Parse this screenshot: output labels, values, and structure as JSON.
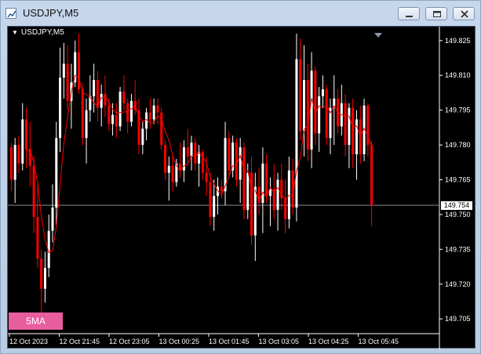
{
  "window": {
    "title": "USDJPY,M5",
    "icon": "chart-window-icon",
    "controls": [
      "minimize-icon",
      "restore-icon",
      "close-icon"
    ]
  },
  "chart": {
    "symbol_label": "USDJPY,M5",
    "indicator_badge": "5MA",
    "current_price": "149.754",
    "colors": {
      "background": "#000000",
      "bull": "#ffffff",
      "bear": "#ff0000",
      "doji": "#00c000",
      "ma_line": "#ff0000",
      "badge": "#e85d9e"
    }
  },
  "chart_data": {
    "type": "candlestick",
    "title": "USDJPY,M5",
    "indicator": "5MA",
    "y_ticks": [
      "149.825",
      "149.810",
      "149.795",
      "149.780",
      "149.765",
      "149.750",
      "149.735",
      "149.720",
      "149.705"
    ],
    "x_ticks": [
      "12 Oct 2023",
      "12 Oct 21:45",
      "12 Oct 23:05",
      "13 Oct 00:25",
      "13 Oct 01:45",
      "13 Oct 03:05",
      "13 Oct 04:25",
      "13 Oct 05:45"
    ],
    "ylim": [
      149.7,
      149.83
    ],
    "current_price": 149.754,
    "candles": [
      [
        149.779,
        149.781,
        149.76,
        149.765
      ],
      [
        149.765,
        149.783,
        149.755,
        149.78
      ],
      [
        149.78,
        149.784,
        149.768,
        149.772
      ],
      [
        149.772,
        149.798,
        149.769,
        149.791
      ],
      [
        149.791,
        149.796,
        149.77,
        149.778
      ],
      [
        149.778,
        149.79,
        149.762,
        149.771
      ],
      [
        149.771,
        149.775,
        149.742,
        149.749
      ],
      [
        149.749,
        149.763,
        149.727,
        149.731
      ],
      [
        149.731,
        149.735,
        149.705,
        149.718
      ],
      [
        149.718,
        149.734,
        149.712,
        149.727
      ],
      [
        149.727,
        149.75,
        149.723,
        149.743
      ],
      [
        149.743,
        149.763,
        149.738,
        149.753
      ],
      [
        149.753,
        149.79,
        149.745,
        149.783
      ],
      [
        149.783,
        149.822,
        149.777,
        149.809
      ],
      [
        149.809,
        149.824,
        149.8,
        149.815
      ],
      [
        149.815,
        149.823,
        149.795,
        149.799
      ],
      [
        149.799,
        149.815,
        149.787,
        149.807
      ],
      [
        149.807,
        149.825,
        149.805,
        149.82
      ],
      [
        149.82,
        149.828,
        149.802,
        149.804
      ],
      [
        149.804,
        149.806,
        149.78,
        149.783
      ],
      [
        149.783,
        149.8,
        149.772,
        149.795
      ],
      [
        149.795,
        149.81,
        149.79,
        149.801
      ],
      [
        149.801,
        149.815,
        149.794,
        149.808
      ],
      [
        149.808,
        149.812,
        149.79,
        149.796
      ],
      [
        149.796,
        149.806,
        149.788,
        149.802
      ],
      [
        149.802,
        149.81,
        149.792,
        149.797
      ],
      [
        149.797,
        149.8,
        149.786,
        149.789
      ],
      [
        149.789,
        149.798,
        149.784,
        149.793
      ],
      [
        149.793,
        149.798,
        149.783,
        149.788
      ],
      [
        149.788,
        149.805,
        149.786,
        149.803
      ],
      [
        149.803,
        149.81,
        149.795,
        149.798
      ],
      [
        149.798,
        149.8,
        149.785,
        149.79
      ],
      [
        149.79,
        149.802,
        149.788,
        149.799
      ],
      [
        149.799,
        149.808,
        149.793,
        149.795
      ],
      [
        149.795,
        149.8,
        149.776,
        149.78
      ],
      [
        149.78,
        149.79,
        149.776,
        149.787
      ],
      [
        149.787,
        149.796,
        149.782,
        149.794
      ],
      [
        149.794,
        149.8,
        149.787,
        149.791
      ],
      [
        149.791,
        149.8,
        149.789,
        149.797
      ],
      [
        149.797,
        149.8,
        149.789,
        149.794
      ],
      [
        149.794,
        149.796,
        149.778,
        149.78
      ],
      [
        149.78,
        149.782,
        149.765,
        149.768
      ],
      [
        149.768,
        149.775,
        149.756,
        149.771
      ],
      [
        149.771,
        149.776,
        149.76,
        149.764
      ],
      [
        149.764,
        149.774,
        149.762,
        149.772
      ],
      [
        149.772,
        149.781,
        149.766,
        149.769
      ],
      [
        149.769,
        149.782,
        149.764,
        149.779
      ],
      [
        149.779,
        149.787,
        149.771,
        149.775
      ],
      [
        149.775,
        149.784,
        149.769,
        149.781
      ],
      [
        149.781,
        149.783,
        149.769,
        149.772
      ],
      [
        149.772,
        149.78,
        149.762,
        149.777
      ],
      [
        149.777,
        149.778,
        149.765,
        149.768
      ],
      [
        149.768,
        149.775,
        149.758,
        149.764
      ],
      [
        149.764,
        149.768,
        149.745,
        149.749
      ],
      [
        149.749,
        149.765,
        149.743,
        149.758
      ],
      [
        149.758,
        149.766,
        149.75,
        149.762
      ],
      [
        149.762,
        149.765,
        149.757,
        149.76
      ],
      [
        149.76,
        149.79,
        149.754,
        149.783
      ],
      [
        149.783,
        149.786,
        149.766,
        149.769
      ],
      [
        149.769,
        149.784,
        149.766,
        149.781
      ],
      [
        149.781,
        149.783,
        149.762,
        149.765
      ],
      [
        149.765,
        149.783,
        149.755,
        149.779
      ],
      [
        149.779,
        149.781,
        149.748,
        149.752
      ],
      [
        149.752,
        149.772,
        149.748,
        149.768
      ],
      [
        149.768,
        149.775,
        149.737,
        149.741
      ],
      [
        149.741,
        149.768,
        149.73,
        149.762
      ],
      [
        149.762,
        149.77,
        149.75,
        149.755
      ],
      [
        149.755,
        149.779,
        149.742,
        149.772
      ],
      [
        149.772,
        149.776,
        149.755,
        149.758
      ],
      [
        149.758,
        149.766,
        149.745,
        149.761
      ],
      [
        149.761,
        149.772,
        149.748,
        149.752
      ],
      [
        149.752,
        149.768,
        149.743,
        149.765
      ],
      [
        149.765,
        149.772,
        149.752,
        149.757
      ],
      [
        149.757,
        149.765,
        149.742,
        149.748
      ],
      [
        149.748,
        149.775,
        149.744,
        149.769
      ],
      [
        149.769,
        149.774,
        149.75,
        149.753
      ],
      [
        149.753,
        149.828,
        149.747,
        149.817
      ],
      [
        149.817,
        149.826,
        149.782,
        149.786
      ],
      [
        149.786,
        149.823,
        149.775,
        149.808
      ],
      [
        149.808,
        149.815,
        149.773,
        149.778
      ],
      [
        149.778,
        149.82,
        149.77,
        149.812
      ],
      [
        149.812,
        149.814,
        149.78,
        149.785
      ],
      [
        149.785,
        149.805,
        149.777,
        149.801
      ],
      [
        149.801,
        149.81,
        149.796,
        149.804
      ],
      [
        149.804,
        149.806,
        149.78,
        149.783
      ],
      [
        149.783,
        149.8,
        149.776,
        149.796
      ],
      [
        149.796,
        149.81,
        149.78,
        149.8
      ],
      [
        149.8,
        149.804,
        149.785,
        149.788
      ],
      [
        149.788,
        149.806,
        149.784,
        149.798
      ],
      [
        149.798,
        149.802,
        149.775,
        149.78
      ],
      [
        149.78,
        149.798,
        149.77,
        149.796
      ],
      [
        149.796,
        149.8,
        149.77,
        149.776
      ],
      [
        149.776,
        149.795,
        149.765,
        149.791
      ],
      [
        149.791,
        149.797,
        149.772,
        149.776
      ],
      [
        149.776,
        149.8,
        149.773,
        149.797
      ],
      [
        149.797,
        149.798,
        149.775,
        149.78
      ],
      [
        149.78,
        149.782,
        149.745,
        149.754
      ]
    ]
  }
}
